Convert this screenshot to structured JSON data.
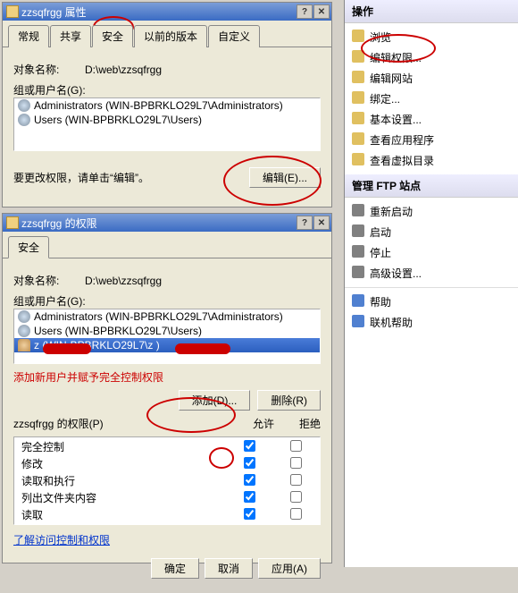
{
  "dialog1": {
    "title": "zzsqfrgg 属性",
    "tabs": [
      "常规",
      "共享",
      "安全",
      "以前的版本",
      "自定义"
    ],
    "active_tab": "安全",
    "object_label": "对象名称:",
    "object_value": "D:\\web\\zzsqfrgg",
    "group_label": "组或用户名(G):",
    "users": [
      "Administrators (WIN-BPBRKLO29L7\\Administrators)",
      "Users (WIN-BPBRKLO29L7\\Users)"
    ],
    "edit_hint": "要更改权限，请单击“编辑”。",
    "edit_btn": "编辑(E)..."
  },
  "dialog2": {
    "title": "zzsqfrgg 的权限",
    "tab": "安全",
    "object_label": "对象名称:",
    "object_value": "D:\\web\\zzsqfrgg",
    "group_label": "组或用户名(G):",
    "users": [
      "Administrators (WIN-BPBRKLO29L7\\Administrators)",
      "Users (WIN-BPBRKLO29L7\\Users)",
      "z       (WIN-BPBRKLO29L7\\z       )"
    ],
    "note": "添加新用户并赋予完全控制权限",
    "add_btn": "添加(D)...",
    "remove_btn": "删除(R)",
    "perm_header": "zzsqfrgg 的权限(P)",
    "allow_hdr": "允许",
    "deny_hdr": "拒绝",
    "perms": [
      {
        "name": "完全控制",
        "allow": true,
        "deny": false
      },
      {
        "name": "修改",
        "allow": true,
        "deny": false
      },
      {
        "name": "读取和执行",
        "allow": true,
        "deny": false
      },
      {
        "name": "列出文件夹内容",
        "allow": true,
        "deny": false
      },
      {
        "name": "读取",
        "allow": true,
        "deny": false
      }
    ],
    "link": "了解访问控制和权限",
    "ok": "确定",
    "cancel": "取消",
    "apply": "应用(A)"
  },
  "sidepanel": {
    "hdr1": "操作",
    "items1": [
      "浏览",
      "编辑权限...",
      "编辑网站",
      "绑定...",
      "基本设置...",
      "查看应用程序",
      "查看虚拟目录"
    ],
    "hdr2": "管理 FTP 站点",
    "items2": [
      "重新启动",
      "启动",
      "停止",
      "高级设置..."
    ],
    "hdr3": "",
    "items3": [
      "帮助",
      "联机帮助"
    ]
  }
}
